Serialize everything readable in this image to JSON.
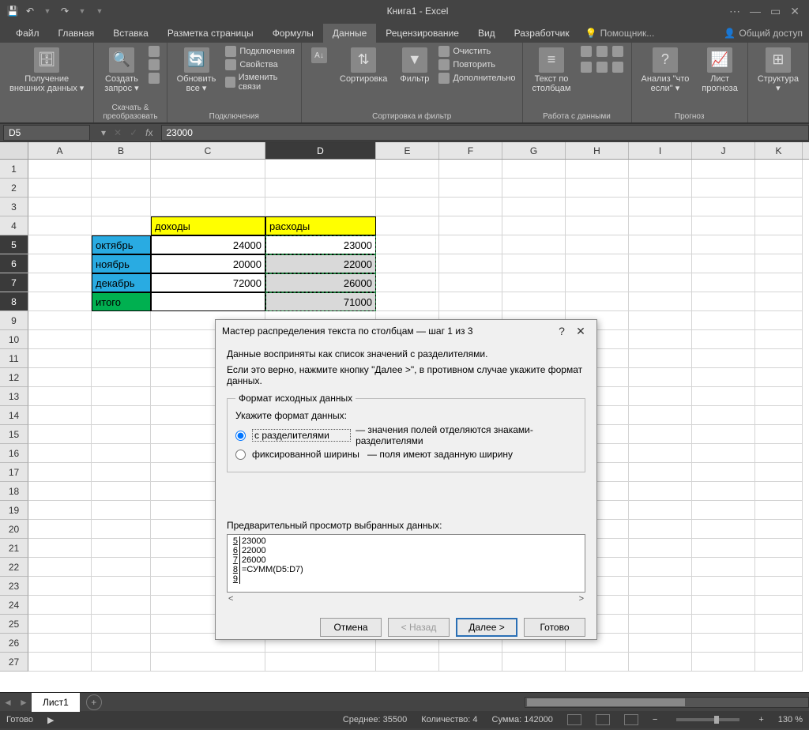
{
  "app": {
    "title": "Книга1 - Excel"
  },
  "qat": {
    "save": "💾",
    "undo": "↶",
    "redo": "↷"
  },
  "win": {
    "min": "—",
    "max": "▭",
    "opts": "⋯",
    "close": "✕"
  },
  "menu": {
    "file": "Файл",
    "home": "Главная",
    "insert": "Вставка",
    "layout": "Разметка страницы",
    "formulas": "Формулы",
    "data": "Данные",
    "review": "Рецензирование",
    "view": "Вид",
    "dev": "Разработчик",
    "tell": "Помощник...",
    "share": "Общий доступ"
  },
  "ribbon": {
    "g1_btn": "Получение\nвнешних данных ▾",
    "g2_btn": "Создать\nзапрос ▾",
    "g2_label": "Скачать & преобразовать",
    "g3_btn": "Обновить\nвсе ▾",
    "g3_i1": "Подключения",
    "g3_i2": "Свойства",
    "g3_i3": "Изменить связи",
    "g3_label": "Подключения",
    "g4_sort": "Сортировка",
    "g4_filter": "Фильтр",
    "g4_i1": "Очистить",
    "g4_i2": "Повторить",
    "g4_i3": "Дополнительно",
    "g4_label": "Сортировка и фильтр",
    "g5_btn": "Текст по\nстолбцам",
    "g5_label": "Работа с данными",
    "g6_b1": "Анализ \"что\nесли\" ▾",
    "g6_b2": "Лист\nпрогноза",
    "g6_label": "Прогноз",
    "g7_btn": "Структура\n▾"
  },
  "namebox": "D5",
  "formula": "23000",
  "cols": [
    "A",
    "B",
    "C",
    "D",
    "E",
    "F",
    "G",
    "H",
    "I",
    "J",
    "K"
  ],
  "table": {
    "hdr_income": "доходы",
    "hdr_expense": "расходы",
    "m1": "октябрь",
    "m2": "ноябрь",
    "m3": "декабрь",
    "tot": "итого",
    "c1": "24000",
    "c2": "20000",
    "c3": "72000",
    "d1": "23000",
    "d2": "22000",
    "d3": "26000",
    "d4": "71000"
  },
  "dialog": {
    "title": "Мастер распределения текста по столбцам — шаг 1 из 3",
    "line1": "Данные восприняты как список значений с разделителями.",
    "line2": "Если это верно, нажмите кнопку \"Далее >\", в противном случае укажите формат данных.",
    "group_title": "Формат исходных данных",
    "prompt": "Укажите формат данных:",
    "r1": "с разделителями",
    "r1_desc": "— значения полей отделяются знаками-разделителями",
    "r2": "фиксированной ширины",
    "r2_desc": "— поля имеют заданную ширину",
    "preview_label": "Предварительный просмотр выбранных данных:",
    "pv": [
      {
        "n": "5",
        "v": "23000"
      },
      {
        "n": "6",
        "v": "22000"
      },
      {
        "n": "7",
        "v": "26000"
      },
      {
        "n": "8",
        "v": "=СУММ(D5:D7)"
      },
      {
        "n": "9",
        "v": ""
      }
    ],
    "cancel": "Отмена",
    "back": "< Назад",
    "next": "Далее >",
    "finish": "Готово"
  },
  "sheet_tab": "Лист1",
  "status": {
    "ready": "Готово",
    "avg": "Среднее: 35500",
    "count": "Количество: 4",
    "sum": "Сумма: 142000",
    "zoom": "130 %"
  }
}
